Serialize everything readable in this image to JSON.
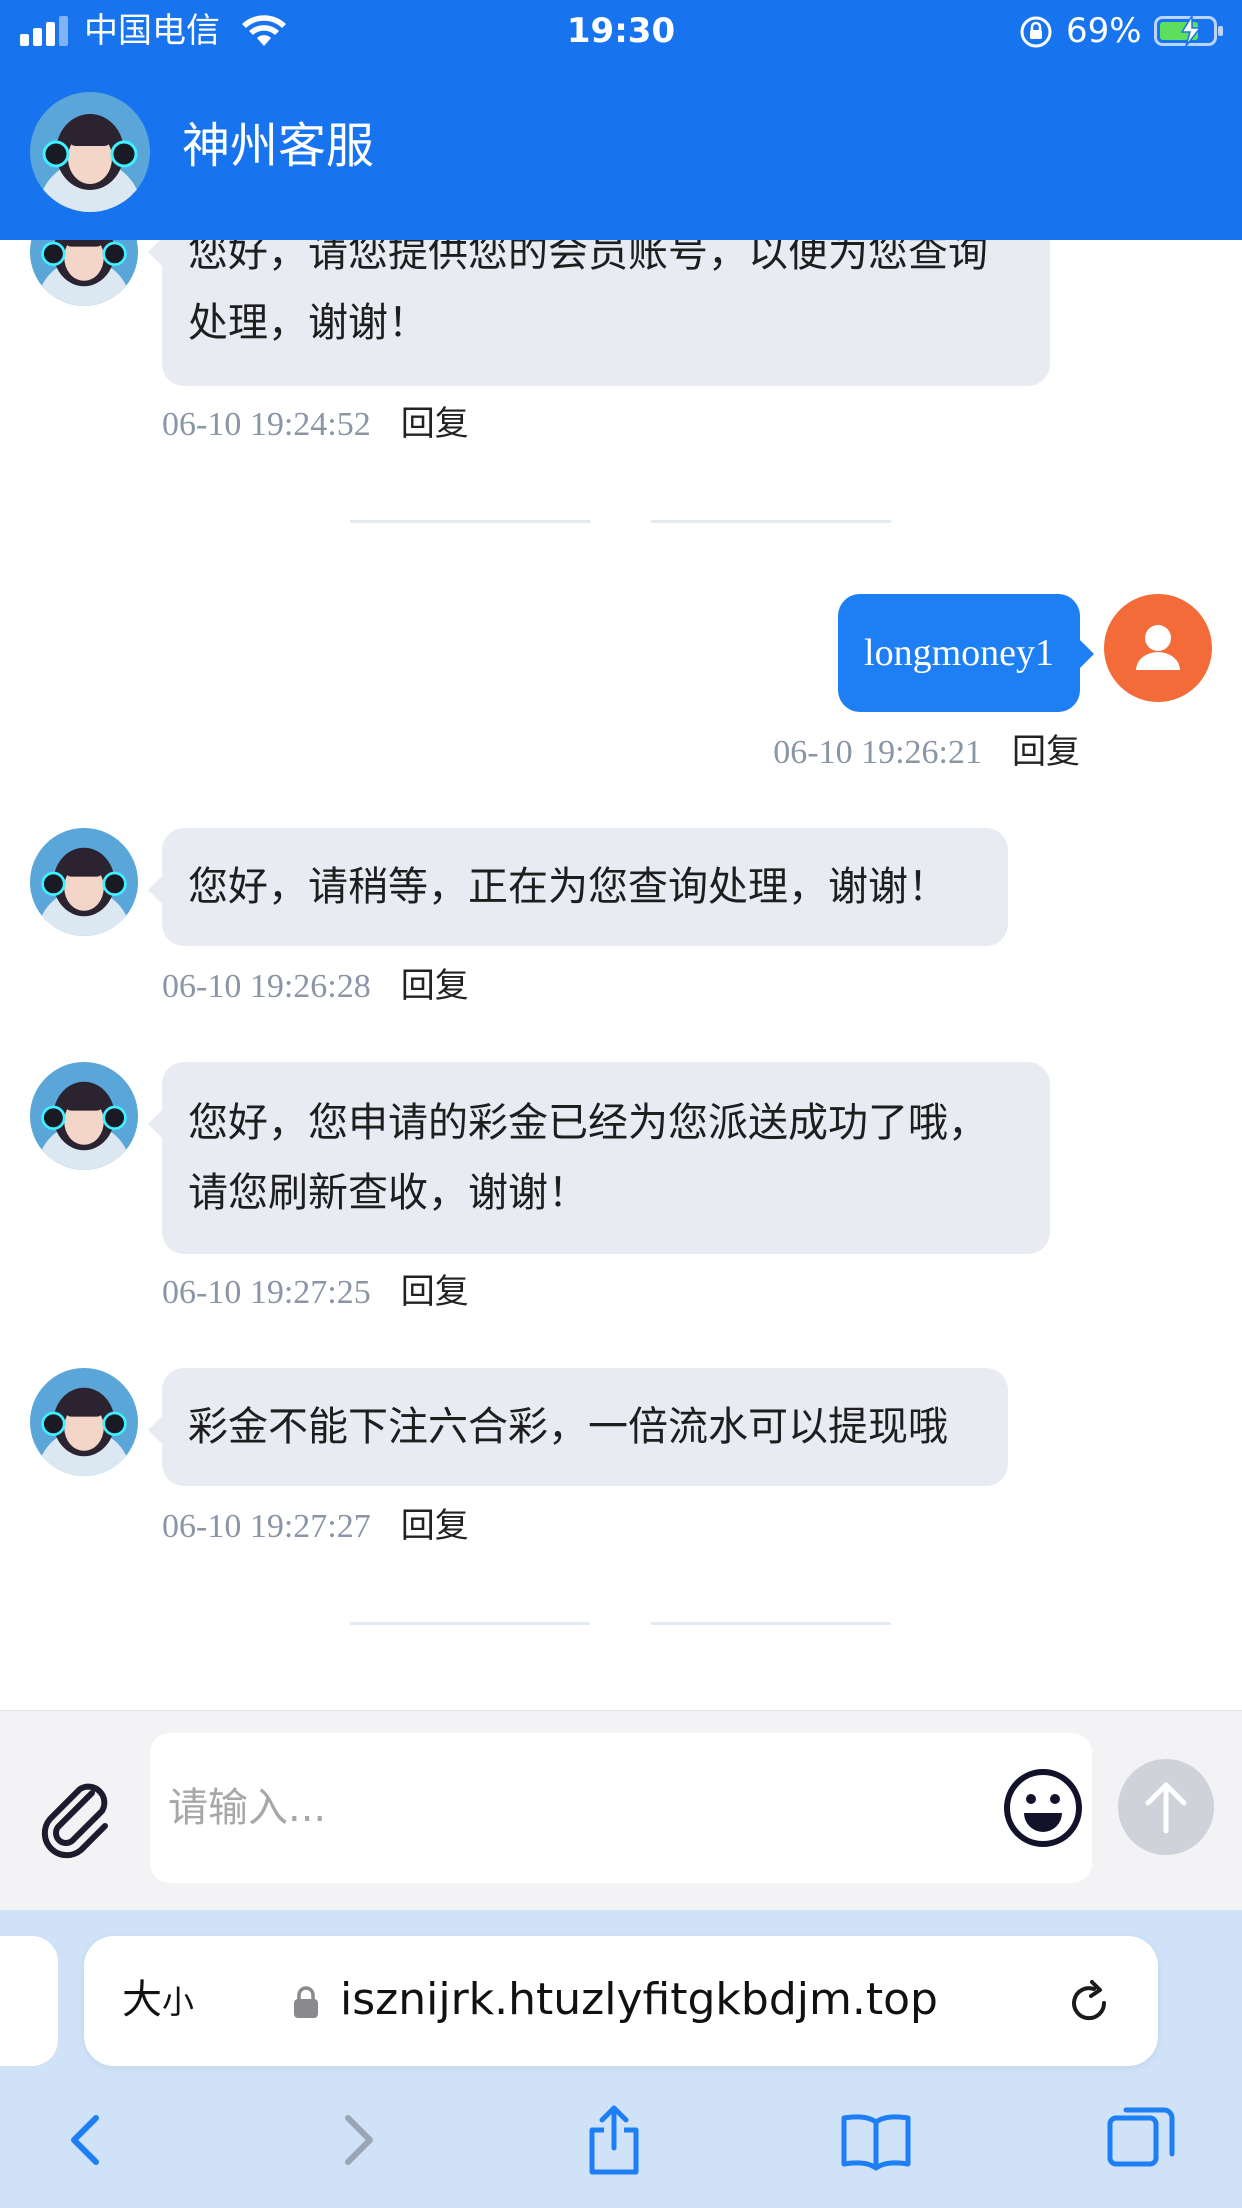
{
  "status_bar": {
    "carrier": "中国电信",
    "time": "19:30",
    "battery": "69%"
  },
  "header": {
    "title": "神州客服"
  },
  "messages": [
    {
      "from": "agent",
      "lines": [
        "您好，请您提供您的会员账号，以便为您查询",
        "处理，谢谢！"
      ],
      "time": "06-10 19:24:52",
      "reply": "回复"
    },
    {
      "from": "user",
      "text": "longmoney1",
      "time": "06-10 19:26:21",
      "reply": "回复"
    },
    {
      "from": "agent",
      "lines": [
        "您好，请稍等，正在为您查询处理，谢谢！"
      ],
      "time": "06-10 19:26:28",
      "reply": "回复"
    },
    {
      "from": "agent",
      "lines": [
        "您好，您申请的彩金已经为您派送成功了哦，",
        "请您刷新查收，谢谢！"
      ],
      "time": "06-10 19:27:25",
      "reply": "回复"
    },
    {
      "from": "agent",
      "lines": [
        "彩金不能下注六合彩，一倍流水可以提现哦"
      ],
      "time": "06-10 19:27:27",
      "reply": "回复"
    }
  ],
  "input": {
    "placeholder": "请输入..."
  },
  "browser": {
    "text_size_big": "大",
    "text_size_small": "小",
    "url": "isznijrk.htuzlyfitgkbdjm.top"
  },
  "icons": {
    "attach": "paperclip-icon",
    "emoji": "smiley-icon",
    "send": "arrow-up-icon",
    "reload": "reload-icon",
    "back": "chevron-left-icon",
    "forward": "chevron-right-icon",
    "share": "share-icon",
    "bookmarks": "book-icon",
    "tabs": "tabs-icon"
  },
  "colors": {
    "header_bg": "#1873ef",
    "user_bubble": "#1e7ff4",
    "agent_bubble": "#e8ebf2",
    "user_avatar": "#f26b38",
    "safari_bg": "#cfe2f7"
  }
}
